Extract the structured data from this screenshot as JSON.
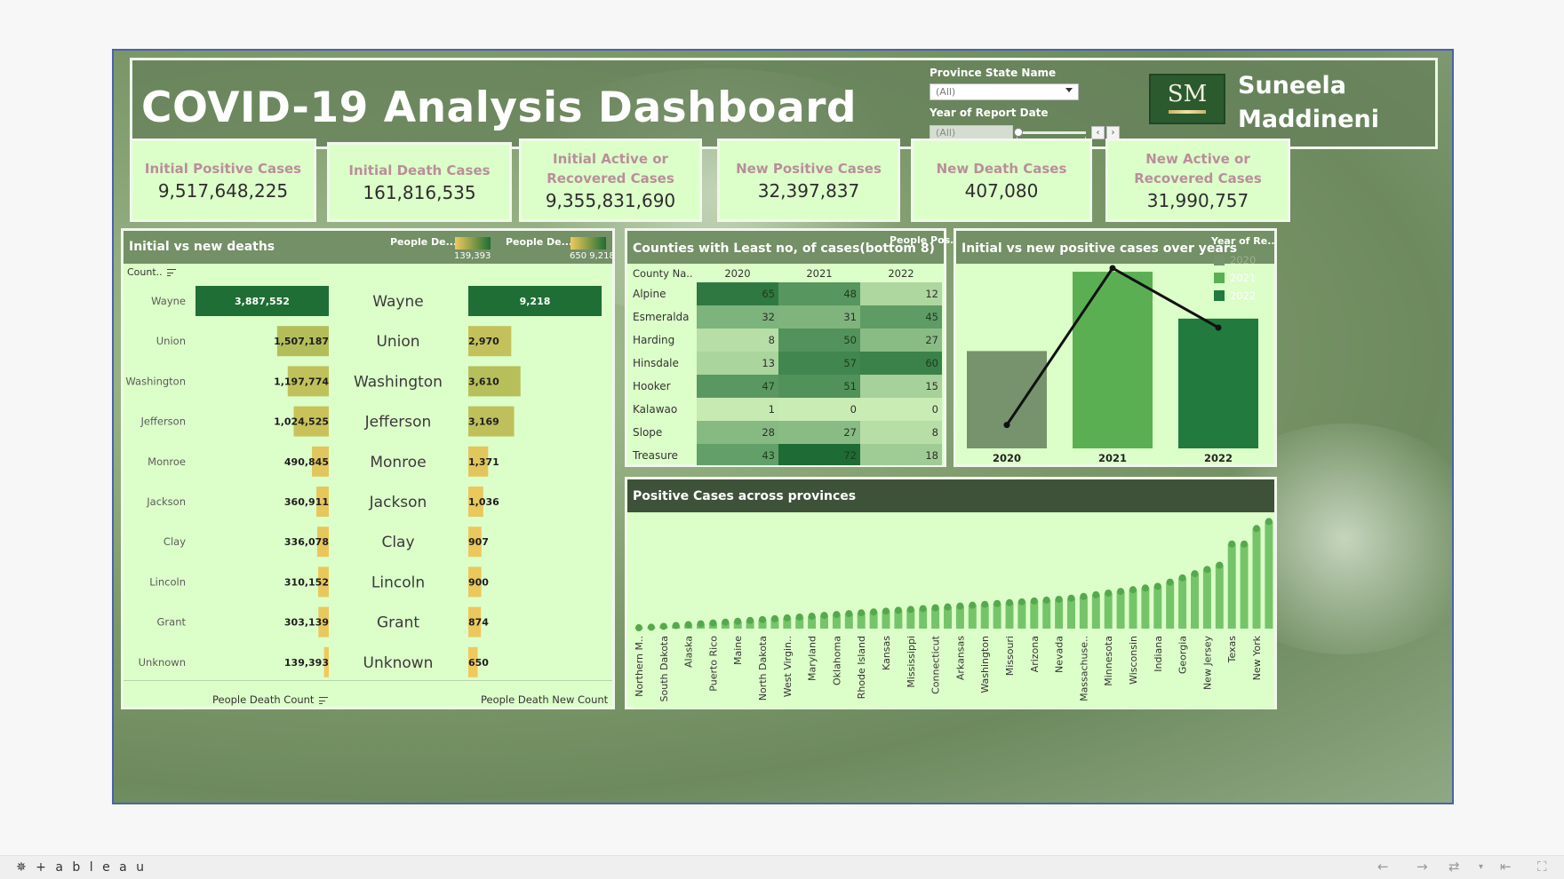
{
  "header": {
    "title": "COVID-19 Analysis Dashboard",
    "province_filter_label": "Province State Name",
    "province_filter_value": "(All)",
    "year_filter_label": "Year of Report Date",
    "year_filter_value": "(All)",
    "logo_text": "SM",
    "author_line1": "Suneela",
    "author_line2": "Maddineni"
  },
  "kpis": [
    {
      "label_line1": "Initial Positive Cases",
      "label_line2": "",
      "value": "9,517,648,225"
    },
    {
      "label_line1": "Initial Death Cases",
      "label_line2": "",
      "value": "161,816,535"
    },
    {
      "label_line1": "Initial Active or",
      "label_line2": "Recovered Cases",
      "value": "9,355,831,690"
    },
    {
      "label_line1": "New Positive Cases",
      "label_line2": "",
      "value": "32,397,837"
    },
    {
      "label_line1": "New Death Cases",
      "label_line2": "",
      "value": "407,080"
    },
    {
      "label_line1": "New Active or",
      "label_line2": "Recovered Cases",
      "value": "31,990,757"
    }
  ],
  "deaths_panel": {
    "title": "Initial vs new deaths",
    "legend1_label": "People De...",
    "legend1_range": "139,393",
    "legend2_label": "People De...",
    "legend2_range": "650  9,218",
    "sort_header": "Count..",
    "footer_left": "People Death Count",
    "footer_right": "People Death New Count",
    "colors": {
      "low": "#f0c95c",
      "mid": "#9dba5a",
      "high": "#1f6e35"
    }
  },
  "heatmap": {
    "title": "Counties with Least no, of cases(bottom 8)",
    "legend_label": "People Pos...",
    "row_header": "County Na..",
    "years": [
      "2020",
      "2021",
      "2022"
    ],
    "rows": [
      {
        "county": "Alpine",
        "values": [
          65,
          48,
          12
        ]
      },
      {
        "county": "Esmeralda",
        "values": [
          32,
          31,
          45
        ]
      },
      {
        "county": "Harding",
        "values": [
          8,
          50,
          27
        ]
      },
      {
        "county": "Hinsdale",
        "values": [
          13,
          57,
          60
        ]
      },
      {
        "county": "Hooker",
        "values": [
          47,
          51,
          15
        ]
      },
      {
        "county": "Kalawao",
        "values": [
          1,
          0,
          0
        ]
      },
      {
        "county": "Slope",
        "values": [
          28,
          27,
          8
        ]
      },
      {
        "county": "Treasure",
        "values": [
          43,
          72,
          18
        ]
      }
    ]
  },
  "year_chart": {
    "title": "Initial vs new positive cases over years",
    "legend_title": "Year of Re...",
    "legend": [
      {
        "year": "2020",
        "color": "#76936d"
      },
      {
        "year": "2021",
        "color": "#5aaf53"
      },
      {
        "year": "2022",
        "color": "#237a3e"
      }
    ]
  },
  "provinces": {
    "title": "Positive Cases across provinces"
  },
  "chart_data": [
    {
      "type": "bar",
      "title": "Initial vs new deaths",
      "categories": [
        "Wayne",
        "Union",
        "Washington",
        "Jefferson",
        "Monroe",
        "Jackson",
        "Clay",
        "Lincoln",
        "Grant",
        "Unknown"
      ],
      "series": [
        {
          "name": "People Death Count",
          "values": [
            3887552,
            1507187,
            1197774,
            1024525,
            490845,
            360911,
            336078,
            310152,
            303139,
            139393
          ]
        },
        {
          "name": "People Death New Count",
          "values": [
            9218,
            2970,
            3610,
            3169,
            1371,
            1036,
            907,
            900,
            874,
            650
          ]
        }
      ],
      "labels_left": [
        "3,887,552",
        "1,507,187",
        "1,197,774",
        "1,024,525",
        "490,845",
        "360,911",
        "336,078",
        "310,152",
        "303,139",
        "139,393"
      ],
      "labels_right": [
        "9,218",
        "2,970",
        "3,610",
        "3,169",
        "1,371",
        "1,036",
        "907",
        "900",
        "874",
        "650"
      ]
    },
    {
      "type": "heatmap",
      "title": "Counties with Least no, of cases(bottom 8)",
      "x": [
        "2020",
        "2021",
        "2022"
      ],
      "y": [
        "Alpine",
        "Esmeralda",
        "Harding",
        "Hinsdale",
        "Hooker",
        "Kalawao",
        "Slope",
        "Treasure"
      ]
    },
    {
      "type": "bar",
      "title": "Initial vs new positive cases over years",
      "categories": [
        "2020",
        "2021",
        "2022"
      ],
      "series": [
        {
          "name": "bars",
          "values": [
            0.54,
            0.98,
            0.72
          ]
        },
        {
          "name": "line",
          "values": [
            0.13,
            1.0,
            0.67
          ]
        }
      ]
    },
    {
      "type": "bar",
      "title": "Positive Cases across provinces",
      "categories": [
        "Northern M..",
        "",
        "South Dakota",
        "",
        "Alaska",
        "",
        "Puerto Rico",
        "",
        "Maine",
        "",
        "North Dakota",
        "",
        "West Virgin..",
        "",
        "Maryland",
        "",
        "Oklahoma",
        "",
        "Rhode Island",
        "",
        "Kansas",
        "",
        "Mississippi",
        "",
        "Connecticut",
        "",
        "Arkansas",
        "",
        "Washington",
        "",
        "Missouri",
        "",
        "Arizona",
        "",
        "Nevada",
        "",
        "Massachuse..",
        "",
        "Minnesota",
        "",
        "Wisconsin",
        "",
        "Indiana",
        "",
        "Georgia",
        "",
        "New Jersey",
        "",
        "Texas",
        "",
        "New York",
        ""
      ],
      "values": [
        0.3,
        0.5,
        0.8,
        1.1,
        1.4,
        1.7,
        2.0,
        2.3,
        2.6,
        2.9,
        3.2,
        3.5,
        3.8,
        4.1,
        4.4,
        4.7,
        5.0,
        5.3,
        5.6,
        5.9,
        6.2,
        6.5,
        6.8,
        7.1,
        7.4,
        7.7,
        8.0,
        8.3,
        8.6,
        8.9,
        9.2,
        9.5,
        9.8,
        10.1,
        10.4,
        10.8,
        11.4,
        12.0,
        12.6,
        13.2,
        13.8,
        14.4,
        15.0,
        16.5,
        18.0,
        19.5,
        21.0,
        22.5,
        30.0,
        30.0,
        35.5,
        38.0
      ],
      "ylim": [
        0,
        40
      ]
    }
  ]
}
